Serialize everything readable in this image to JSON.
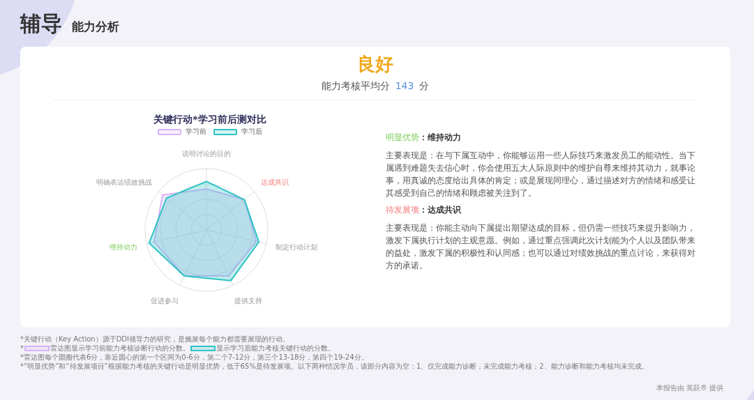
{
  "header": {
    "title": "辅导",
    "subtitle": "能力分析"
  },
  "summary": {
    "grade": "良好",
    "score_label": "能力考核平均分",
    "score": "143",
    "score_unit": "分"
  },
  "chart": {
    "title": "关键行动*学习前后测对比",
    "legend": [
      {
        "label": "学习前",
        "color": "#d8b4f8"
      },
      {
        "label": "学习后",
        "color": "#2ec4c4"
      }
    ],
    "axes": [
      {
        "label": "说明讨论的目的",
        "kind": "normal"
      },
      {
        "label": "达成共识",
        "kind": "weakness"
      },
      {
        "label": "制定行动计划",
        "kind": "normal"
      },
      {
        "label": "提供支持",
        "kind": "normal"
      },
      {
        "label": "促进参与",
        "kind": "normal"
      },
      {
        "label": "维持动力",
        "kind": "strength"
      },
      {
        "label": "明确表达绩效挑战",
        "kind": "normal"
      }
    ]
  },
  "findings": [
    {
      "tag": "明显优势",
      "kind": "strength",
      "title": "：维持动力",
      "text": "主要表现是：在与下属互动中，你能够运用一些人际技巧来激发员工的能动性。当下属遇到难题失去信心时，你会使用五大人际原则中的维护自尊来维持其动力，就事论事，用真诚的态度给出具体的肯定；或是展现同理心，通过描述对方的情绪和感受让其感受到自己的情绪和顾虑被关注到了。"
    },
    {
      "tag": "待发展项",
      "kind": "weakness",
      "title": "：达成共识",
      "text": "主要表现是：你能主动向下属提出期望达成的目标，但仍需一些技巧来提升影响力，激发下属执行计划的主观意愿。例如，通过重点强调此次计划能为个人以及团队带来的益处，激发下属的积极性和认同感；也可以通过对绩效挑战的重点讨论，来获得对方的承诺。"
    }
  ],
  "notes": [
    {
      "kind": "text",
      "text": "*关键行动（Key Action）源于DDI领导力的研究，是施展每个能力都需要展现的行动。"
    },
    {
      "kind": "swatches",
      "prefix": "*",
      "items": [
        {
          "text": "雷达图显示学习前能力考核诊断行动的分数。"
        },
        {
          "text": "显示学习后能力考核关键行动的分数。"
        }
      ]
    },
    {
      "kind": "text",
      "text": "*雷达图每个圆圈代表6分，靠近圆心的第一个区间为0-6分，第二个7-12分，第三个13-18分，第四个19-24分。"
    },
    {
      "kind": "text",
      "text": "*“明显优势”和“待发展项目”根据能力考核的关键行动是明显优势，低于65%是待发展项。以下两种情况学员，该部分内容为空：1、仅完成能力诊断，未完成能力考核；2、能力诊断和能力考核均未完成。"
    }
  ],
  "credit": "本报告由 英跃® 提供"
}
